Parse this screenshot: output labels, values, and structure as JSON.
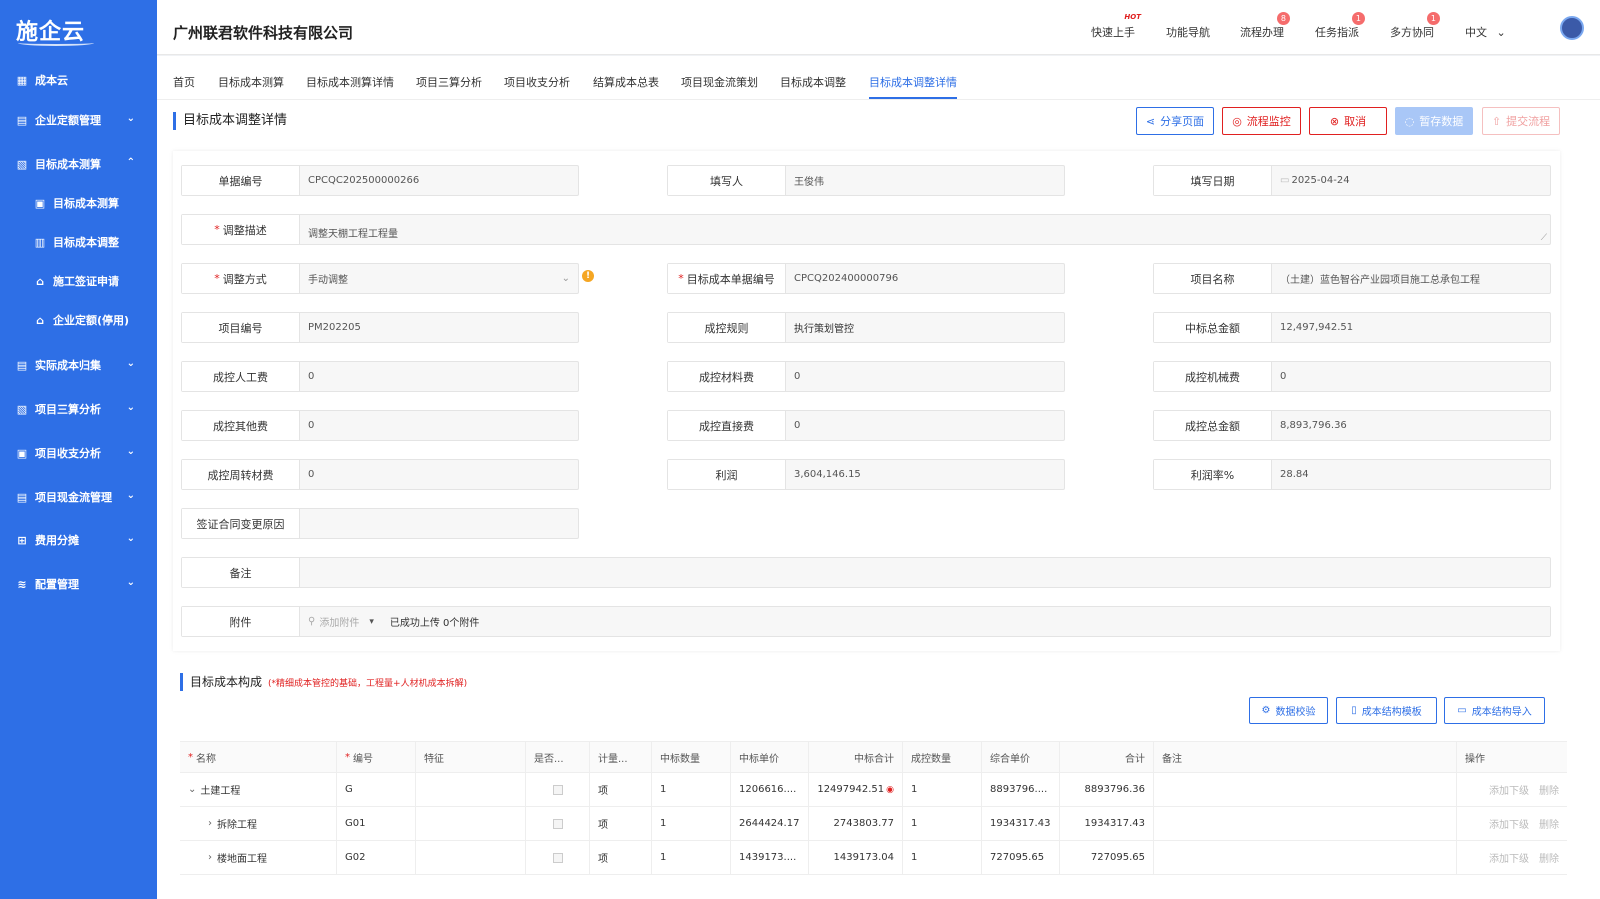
{
  "sidebar": {
    "logo": "施企云",
    "items": [
      {
        "label": "成本云",
        "icon": "grid-icon",
        "glyph": "▦"
      },
      {
        "label": "企业定额管理",
        "icon": "book-icon",
        "glyph": "▤",
        "chev": "⌄"
      },
      {
        "label": "目标成本测算",
        "icon": "calc-icon",
        "glyph": "▧",
        "chev": "⌃"
      },
      {
        "label": "目标成本测算",
        "icon": "doc-calc-icon",
        "glyph": "▣"
      },
      {
        "label": "目标成本调整",
        "icon": "chart-icon",
        "glyph": "▥"
      },
      {
        "label": "施工签证申请",
        "icon": "house-icon",
        "glyph": "⌂"
      },
      {
        "label": "企业定额(停用)",
        "icon": "house-icon",
        "glyph": "⌂"
      },
      {
        "label": "实际成本归集",
        "icon": "ledger-icon",
        "glyph": "▤",
        "chev": "⌄"
      },
      {
        "label": "项目三算分析",
        "icon": "analysis-icon",
        "glyph": "▧",
        "chev": "⌄"
      },
      {
        "label": "项目收支分析",
        "icon": "money-icon",
        "glyph": "▣",
        "chev": "⌄"
      },
      {
        "label": "项目现金流管理",
        "icon": "cashflow-icon",
        "glyph": "▤",
        "chev": "⌄"
      },
      {
        "label": "费用分摊",
        "icon": "apps-icon",
        "glyph": "⊞",
        "chev": "⌄"
      },
      {
        "label": "配置管理",
        "icon": "layers-icon",
        "glyph": "≋",
        "chev": "⌄"
      }
    ]
  },
  "header": {
    "company": "广州联君软件科技有限公司",
    "tools": [
      {
        "label": "快速上手",
        "hot": "HOT"
      },
      {
        "label": "功能导航"
      },
      {
        "label": "流程办理",
        "badge": "8"
      },
      {
        "label": "任务指派",
        "badge": "1"
      },
      {
        "label": "多方协同",
        "badge": "1"
      }
    ],
    "language": "中文",
    "lang_chev": "⌄"
  },
  "tabs": [
    "首页",
    "目标成本测算",
    "目标成本测算详情",
    "项目三算分析",
    "项目收支分析",
    "结算成本总表",
    "项目现金流策划",
    "目标成本调整",
    "目标成本调整详情"
  ],
  "page": {
    "title": "目标成本调整详情",
    "buttons": {
      "share": "分享页面",
      "monitor": "流程监控",
      "cancel": "取消",
      "save": "暂存数据",
      "submit": "提交流程"
    }
  },
  "form": {
    "doc_no": {
      "label": "单据编号",
      "value": "CPCQC202500000266"
    },
    "writer": {
      "label": "填写人",
      "value": "王俊伟"
    },
    "date": {
      "label": "填写日期",
      "value": "2025-04-24"
    },
    "desc": {
      "label": "调整描述",
      "value": "调整天棚工程工程量"
    },
    "method": {
      "label": "调整方式",
      "value": "手动调整"
    },
    "target_no": {
      "label": "目标成本单据编号",
      "value": "CPCQ202400000796"
    },
    "project_name": {
      "label": "项目名称",
      "value": "（土建）蓝色智谷产业园项目施工总承包工程"
    },
    "project_no": {
      "label": "项目编号",
      "value": "PM202205"
    },
    "rule": {
      "label": "成控规则",
      "value": "执行策划管控"
    },
    "bid_total": {
      "label": "中标总金额",
      "value": "12,497,942.51"
    },
    "labor": {
      "label": "成控人工费",
      "value": "0"
    },
    "material": {
      "label": "成控材料费",
      "value": "0"
    },
    "machine": {
      "label": "成控机械费",
      "value": "0"
    },
    "other": {
      "label": "成控其他费",
      "value": "0"
    },
    "direct": {
      "label": "成控直接费",
      "value": "0"
    },
    "total": {
      "label": "成控总金额",
      "value": "8,893,796.36"
    },
    "turnover": {
      "label": "成控周转材费",
      "value": "0"
    },
    "profit": {
      "label": "利润",
      "value": "3,604,146.15"
    },
    "profit_rate": {
      "label": "利润率%",
      "value": "28.84"
    },
    "reason": {
      "label": "签证合同变更原因",
      "value": ""
    },
    "remark": {
      "label": "备注",
      "value": ""
    },
    "attach": {
      "label": "附件",
      "add": "添加附件",
      "status": "已成功上传 0个附件"
    }
  },
  "composition": {
    "title": "目标成本构成",
    "note": "(*精细成本管控的基础，工程量+人材机成本拆解)",
    "buttons": {
      "check": "数据校验",
      "template": "成本结构模板",
      "import": "成本结构导入"
    },
    "columns": [
      "名称",
      "编号",
      "特征",
      "是否...",
      "计量...",
      "中标数量",
      "中标单价",
      "中标合计",
      "成控数量",
      "综合单价",
      "合计",
      "备注",
      "操作"
    ],
    "rows": [
      {
        "name": "土建工程",
        "code": "G",
        "unit": "项",
        "bid_qty": "1",
        "bid_price": "1206616....",
        "bid_total": "12497942.51",
        "qty": "1",
        "price": "8893796....",
        "total": "8893796.36",
        "add": "添加下级",
        "del": "删除",
        "arrow": "⌄"
      },
      {
        "name": "拆除工程",
        "code": "G01",
        "unit": "项",
        "bid_qty": "1",
        "bid_price": "2644424.17",
        "bid_total": "2743803.77",
        "qty": "1",
        "price": "1934317.43",
        "total": "1934317.43",
        "add": "添加下级",
        "del": "删除",
        "arrow": "›"
      },
      {
        "name": "楼地面工程",
        "code": "G02",
        "unit": "项",
        "bid_qty": "1",
        "bid_price": "1439173....",
        "bid_total": "1439173.04",
        "qty": "1",
        "price": "727095.65",
        "total": "727095.65",
        "add": "添加下级",
        "del": "删除",
        "arrow": "›"
      }
    ]
  }
}
